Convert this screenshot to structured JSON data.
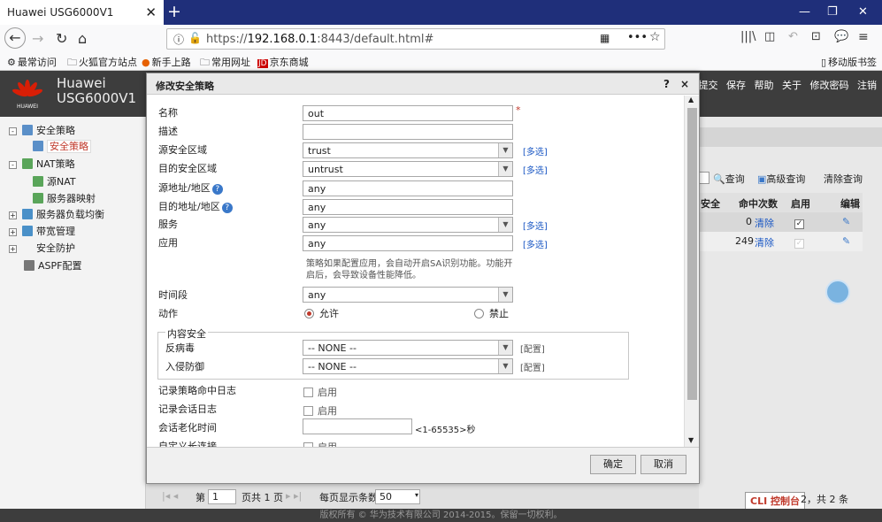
{
  "browser": {
    "tab_title": "Huawei USG6000V1",
    "url_host": "192.168.0.1",
    "url_rest": ":8443/default.html#",
    "url_scheme": "https://",
    "bookmarks": [
      "最常访问",
      "火狐官方站点",
      "新手上路",
      "常用网址",
      "京东商城"
    ],
    "mobile_bookmarks": "移动版书签"
  },
  "app": {
    "brand": "Huawei",
    "model": "USG6000V1",
    "logo_text": "HUAWEI",
    "menu": [
      "提交",
      "保存",
      "帮助",
      "关于",
      "修改密码",
      "注销"
    ]
  },
  "sidebar": {
    "items": [
      {
        "label": "安全策略",
        "expander": "-"
      },
      {
        "label": "安全策略"
      },
      {
        "label": "NAT策略",
        "expander": "-"
      },
      {
        "label": "源NAT"
      },
      {
        "label": "服务器映射"
      },
      {
        "label": "服务器负载均衡",
        "expander": "+"
      },
      {
        "label": "带宽管理",
        "expander": "+"
      },
      {
        "label": "安全防护",
        "expander": "+"
      },
      {
        "label": "ASPF配置"
      }
    ]
  },
  "right": {
    "query": "查询",
    "advanced": "高级查询",
    "clear": "清除查询",
    "columns": [
      "安全",
      "命中次数",
      "启用",
      "编辑"
    ],
    "rows": [
      {
        "hits": "0",
        "clear": "清除"
      },
      {
        "hits": "249",
        "clear": "清除"
      }
    ]
  },
  "dialog": {
    "title": "修改安全策略",
    "help": "?",
    "close": "×",
    "labels": {
      "name": "名称",
      "desc": "描述",
      "src_zone": "源安全区域",
      "dst_zone": "目的安全区域",
      "src_addr": "源地址/地区",
      "dst_addr": "目的地址/地区",
      "service": "服务",
      "app": "应用",
      "time": "时间段",
      "action": "动作",
      "content": "内容安全",
      "av": "反病毒",
      "ips": "入侵防御",
      "log_hit": "记录策略命中日志",
      "log_session": "记录会话日志",
      "aging": "会话老化时间",
      "custom_long": "自定义长连接"
    },
    "values": {
      "name": "out",
      "desc": "",
      "src_zone": "trust",
      "dst_zone": "untrust",
      "src_addr": "any",
      "dst_addr": "any",
      "service": "any",
      "app": "any",
      "time": "any",
      "av": "-- NONE --",
      "ips": "-- NONE --",
      "aging": ""
    },
    "multi": "[多选]",
    "config": "[配置]",
    "note": "策略如果配置应用，会自动开启SA识别功能。功能开启后，会导致设备性能降低。",
    "allow": "允许",
    "deny": "禁止",
    "enable": "启用",
    "aging_range": "<1-65535>秒",
    "required": "*",
    "ok": "确定",
    "cancel": "取消"
  },
  "pager": {
    "page_label": "第",
    "page": "1",
    "total": "页共 1 页",
    "per_page": "每页显示条数",
    "per_value": "50"
  },
  "cli": "CLI 控制台",
  "pageinfo": "2，共 2 条",
  "footer": "版权所有 © 华为技术有限公司 2014-2015。保留一切权利。"
}
